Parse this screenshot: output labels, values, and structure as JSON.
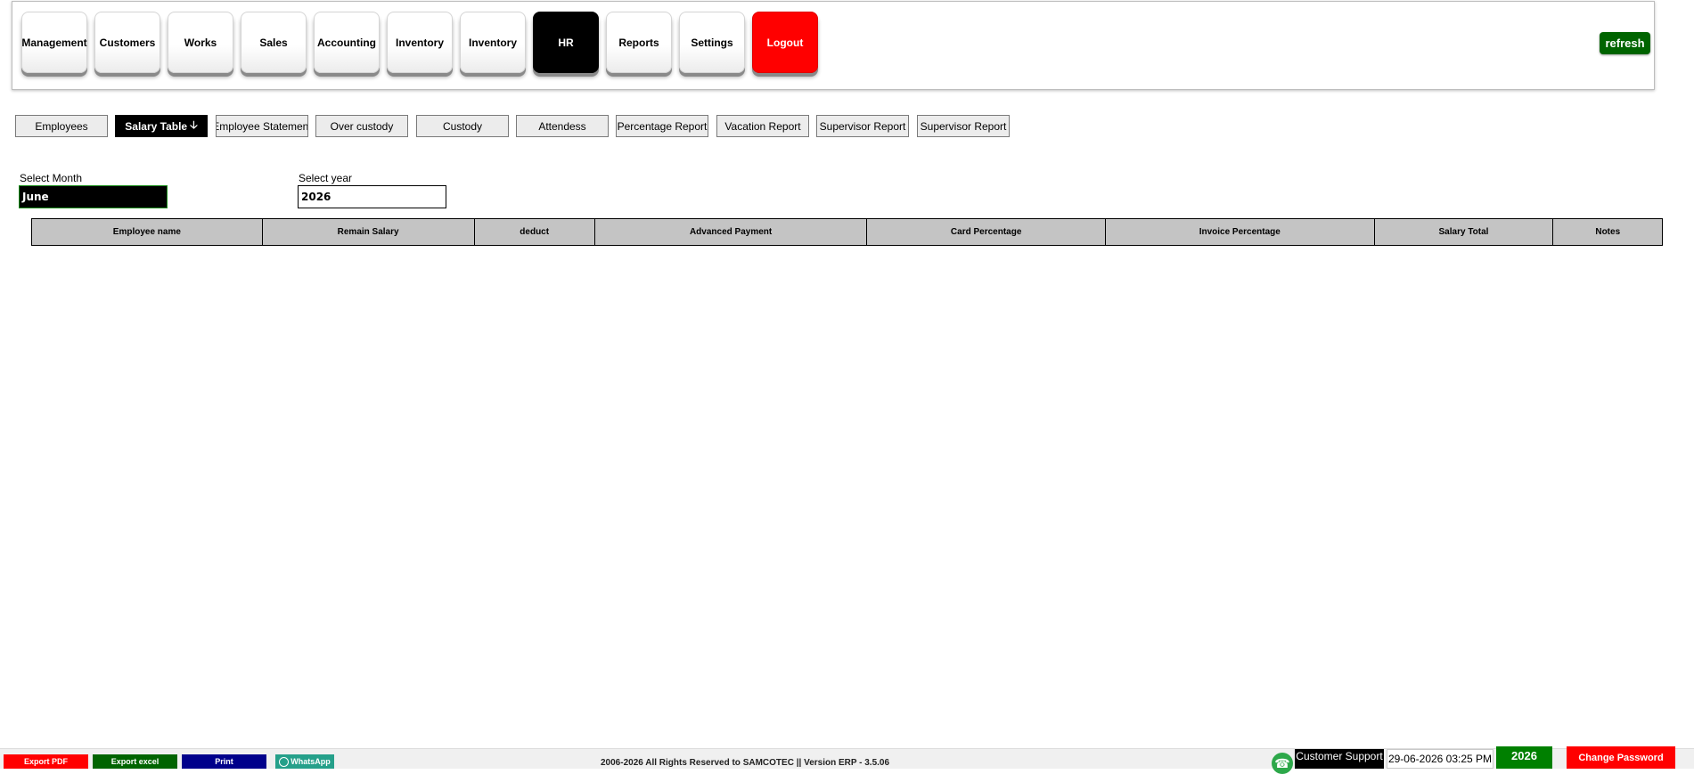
{
  "nav": {
    "items": [
      {
        "label": "Management"
      },
      {
        "label": "Customers"
      },
      {
        "label": "Works"
      },
      {
        "label": "Sales"
      },
      {
        "label": "Accounting"
      },
      {
        "label": "Inventory"
      },
      {
        "label": "Inventory"
      },
      {
        "label": "HR"
      },
      {
        "label": "Reports"
      },
      {
        "label": "Settings"
      },
      {
        "label": "Logout"
      }
    ],
    "refresh_label": "refresh"
  },
  "sub_tabs": [
    {
      "label": "Employees"
    },
    {
      "label": "Salary Table"
    },
    {
      "label": "Employee Statement"
    },
    {
      "label": "Over custody"
    },
    {
      "label": "Custody"
    },
    {
      "label": "Attendess"
    },
    {
      "label": "Percentage Report"
    },
    {
      "label": "Vacation Report"
    },
    {
      "label": "Supervisor Report"
    },
    {
      "label": "Supervisor Report"
    }
  ],
  "filters": {
    "month_label": "Select Month",
    "month_value": "June",
    "year_label": "Select year",
    "year_value": "2026"
  },
  "table": {
    "columns": [
      "Employee name",
      "Remain Salary",
      "deduct",
      "Advanced Payment",
      "Card Percentage",
      "Invoice Percentage",
      "Salary Total",
      "Notes"
    ],
    "rows": []
  },
  "footer": {
    "export_pdf": "Export PDF",
    "export_excel": "Export excel",
    "print": "Print",
    "whatsapp": "WhatsApp",
    "copyright": "2006-2026 All Rights Reserved to SAMCOTEC || Version ERP - 3.5.06",
    "support_label": "Customer Support",
    "datetime": "29-06-2026 03:25 PM",
    "year": "2026",
    "change_password": "Change Password"
  },
  "colors": {
    "active_nav": "#000000",
    "logout": "#ff0000",
    "refresh": "#006400",
    "export_pdf": "#ff0000",
    "export_excel": "#006400",
    "print": "#00008b",
    "whatsapp": "#25a08a",
    "table_header": "#c4c4c4"
  },
  "icons": {
    "sort_arrow": "arrow-down-icon",
    "whatsapp": "whatsapp-icon"
  }
}
